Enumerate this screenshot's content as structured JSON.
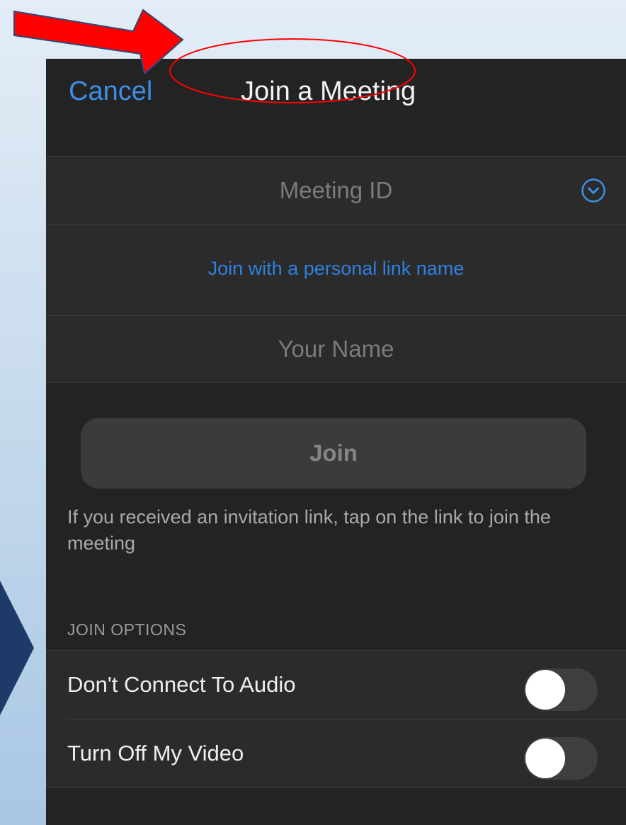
{
  "header": {
    "cancel_label": "Cancel",
    "title": "Join a Meeting"
  },
  "meeting_id": {
    "placeholder": "Meeting ID",
    "value": ""
  },
  "personal_link": {
    "label": "Join with a personal link name"
  },
  "your_name": {
    "placeholder": "Your Name",
    "value": ""
  },
  "join_button": {
    "label": "Join"
  },
  "hint": {
    "text": "If you received an invitation link, tap on the link to join the meeting"
  },
  "join_options": {
    "header": "JOIN OPTIONS",
    "items": [
      {
        "label": "Don't Connect To Audio",
        "on": false
      },
      {
        "label": "Turn Off My Video",
        "on": false
      }
    ]
  },
  "colors": {
    "accent": "#3d8ee6",
    "link": "#2f80e0",
    "screen_bg": "#232323",
    "row_bg": "#2b2b2b",
    "annotation_red": "#ff0000",
    "slide_navy": "#1f3a68"
  },
  "icons": {
    "dropdown": "chevron-down-circle-icon",
    "annotation_arrow": "red-arrow-icon",
    "annotation_ellipse": "red-ellipse-highlight",
    "slide_chevron": "navy-chevron-shape"
  }
}
